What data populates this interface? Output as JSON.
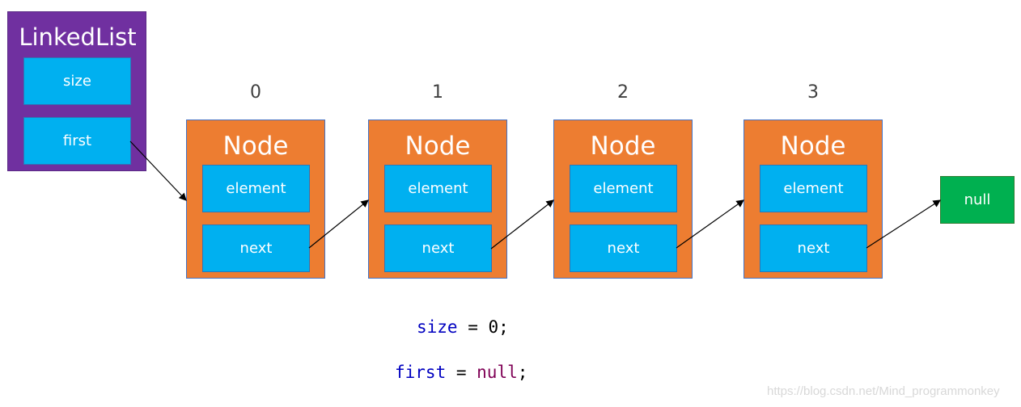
{
  "linked_list": {
    "title": "LinkedList",
    "size_label": "size",
    "first_label": "first"
  },
  "nodes": [
    {
      "index": "0",
      "title": "Node",
      "element": "element",
      "next": "next"
    },
    {
      "index": "1",
      "title": "Node",
      "element": "element",
      "next": "next"
    },
    {
      "index": "2",
      "title": "Node",
      "element": "element",
      "next": "next"
    },
    {
      "index": "3",
      "title": "Node",
      "element": "element",
      "next": "next"
    }
  ],
  "null_box": "null",
  "code": {
    "line1": {
      "var": "size",
      "op": " = ",
      "val": "0",
      "end": ";"
    },
    "line2": {
      "var": "first",
      "op": " = ",
      "val": "null",
      "end": ";"
    }
  },
  "watermark": "https://blog.csdn.net/Mind_programmonkey",
  "colors": {
    "linked_list": "#7030a0",
    "field": "#00b0f0",
    "node": "#ed7d31",
    "null": "#00b050"
  }
}
